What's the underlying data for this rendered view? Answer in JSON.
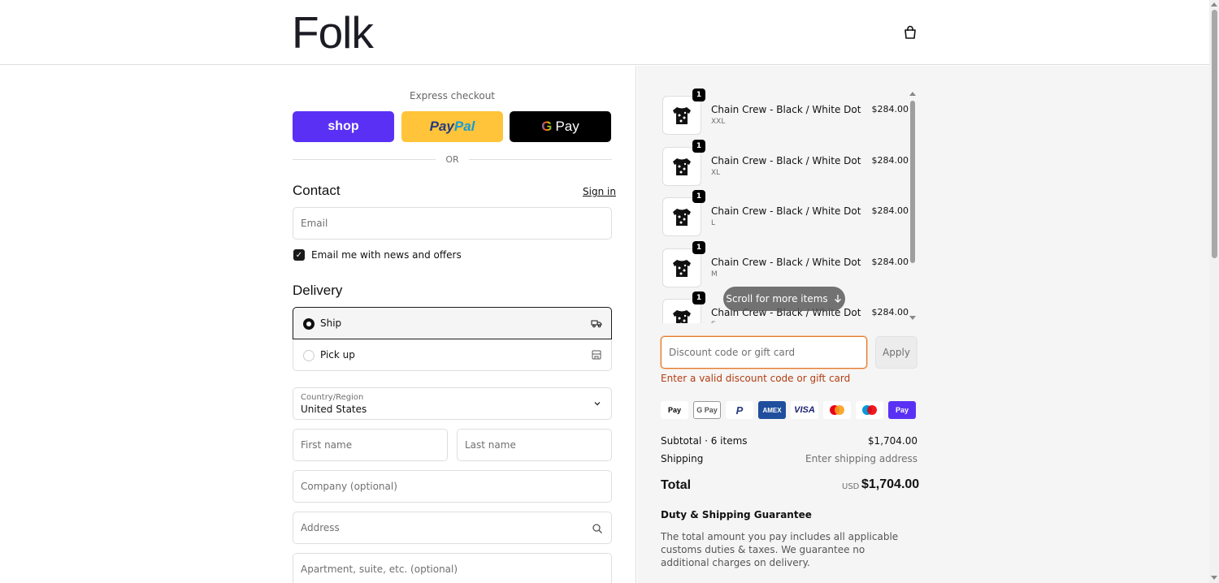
{
  "header": {
    "logo": "Folk",
    "cart_icon": "shopping-bag-icon"
  },
  "express": {
    "label": "Express checkout",
    "shop_label": "shop",
    "paypal_label_1": "Pay",
    "paypal_label_2": "Pal",
    "gpay_g": "G",
    "gpay_label": "Pay",
    "or_label": "OR"
  },
  "contact": {
    "title": "Contact",
    "sign_in": "Sign in",
    "email_placeholder": "Email",
    "newsletter_checked": true,
    "newsletter_label": "Email me with news and offers"
  },
  "delivery": {
    "title": "Delivery",
    "options": [
      {
        "label": "Ship",
        "selected": true,
        "icon": "truck-icon"
      },
      {
        "label": "Pick up",
        "selected": false,
        "icon": "store-icon"
      }
    ],
    "country_label": "Country/Region",
    "country_value": "United States",
    "first_name_placeholder": "First name",
    "last_name_placeholder": "Last name",
    "company_placeholder": "Company (optional)",
    "address_placeholder": "Address",
    "apartment_placeholder": "Apartment, suite, etc. (optional)"
  },
  "cart": {
    "items": [
      {
        "qty": "1",
        "name": "Chain Crew - Black / White Dot",
        "variant": "XXL",
        "price": "$284.00"
      },
      {
        "qty": "1",
        "name": "Chain Crew - Black / White Dot",
        "variant": "XL",
        "price": "$284.00"
      },
      {
        "qty": "1",
        "name": "Chain Crew - Black / White Dot",
        "variant": "L",
        "price": "$284.00"
      },
      {
        "qty": "1",
        "name": "Chain Crew - Black / White Dot",
        "variant": "M",
        "price": "$284.00"
      },
      {
        "qty": "1",
        "name": "Chain Crew - Black / White Dot",
        "variant": "S",
        "price": "$284.00"
      }
    ],
    "scroll_hint": "Scroll for more items",
    "discount_placeholder": "Discount code or gift card",
    "apply_label": "Apply",
    "discount_error": "Enter a valid discount code or gift card",
    "payment_icons": [
      {
        "name": "apple-pay-icon",
        "text": "Pay"
      },
      {
        "name": "google-pay-icon",
        "text": "G Pay"
      },
      {
        "name": "paypal-icon",
        "text": "P"
      },
      {
        "name": "amex-icon",
        "text": "AMEX"
      },
      {
        "name": "visa-icon",
        "text": "VISA"
      },
      {
        "name": "mastercard-icon",
        "text": ""
      },
      {
        "name": "maestro-icon",
        "text": ""
      },
      {
        "name": "shop-pay-icon",
        "text": "Pay"
      }
    ],
    "subtotal_label": "Subtotal · 6 items",
    "subtotal_value": "$1,704.00",
    "shipping_label": "Shipping",
    "shipping_value": "Enter shipping address",
    "total_label": "Total",
    "total_currency": "USD",
    "total_value": "$1,704.00",
    "guarantee_title": "Duty & Shipping Guarantee",
    "guarantee_text": "The total amount you pay includes all applicable customs duties & taxes. We guarantee no additional charges on delivery."
  },
  "colors": {
    "shop": "#5a31f4",
    "paypal": "#ffc439",
    "error": "#b33d12"
  }
}
